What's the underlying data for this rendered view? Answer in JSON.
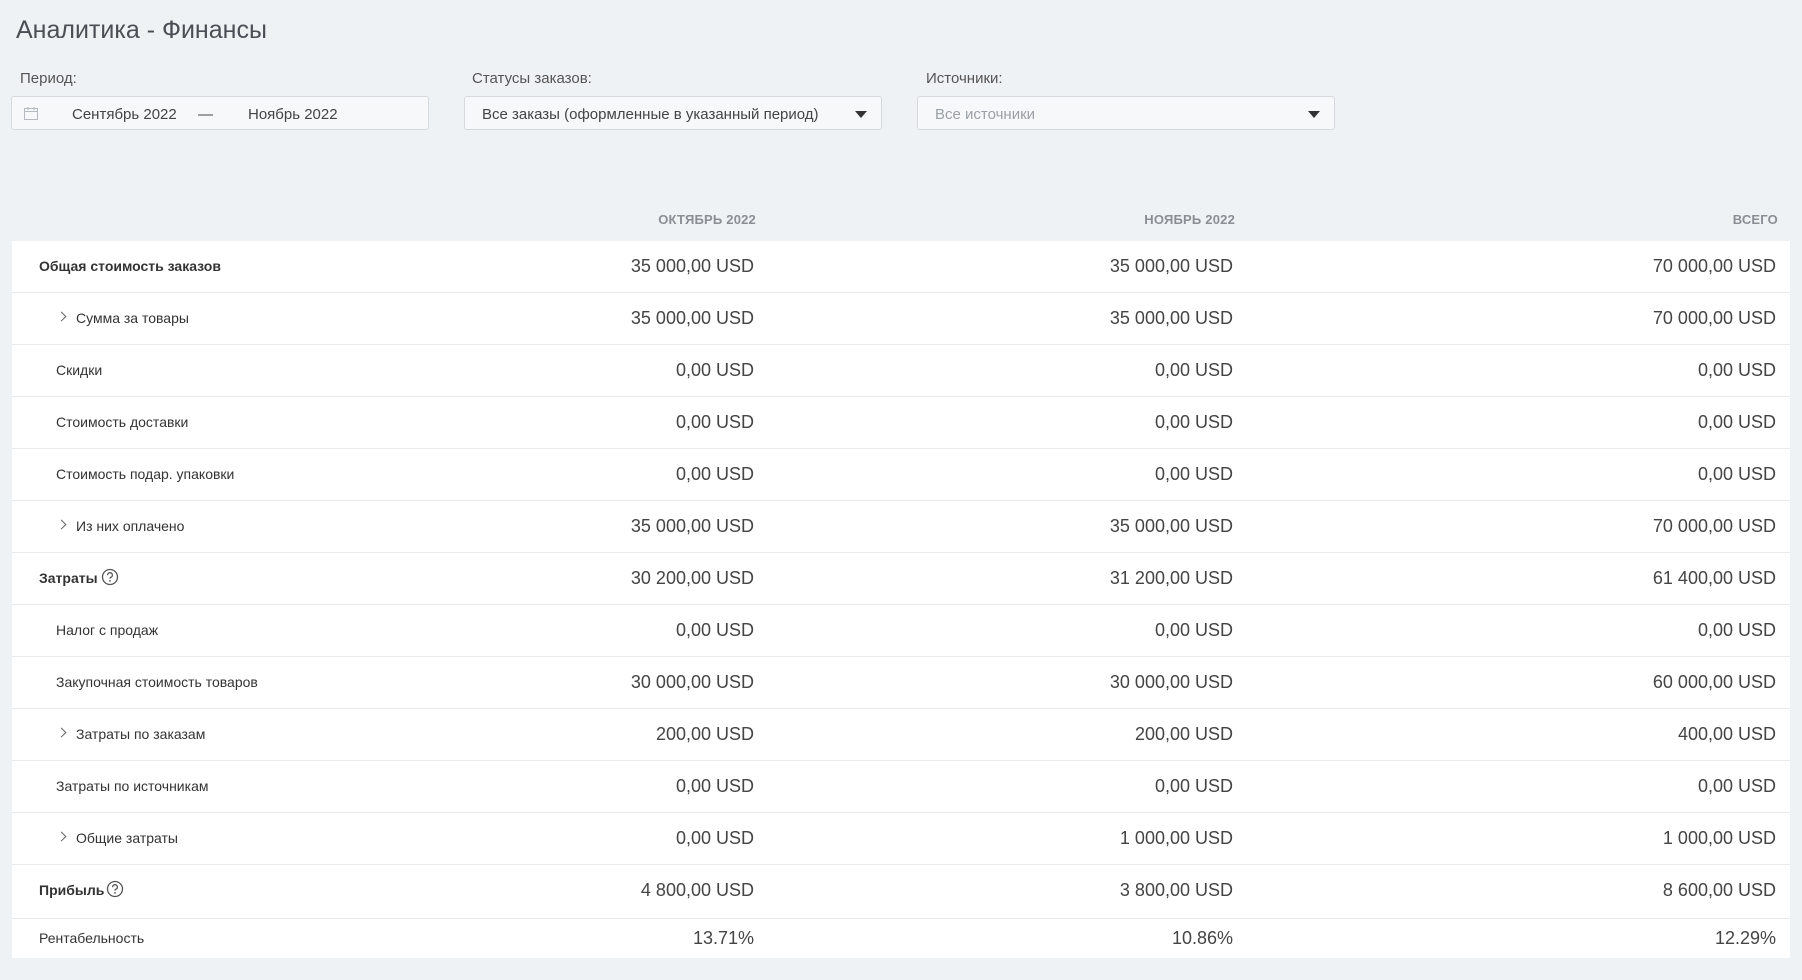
{
  "page_title": "Аналитика - Финансы",
  "filters": {
    "period": {
      "label": "Период:",
      "from": "Сентябрь 2022",
      "separator": "—",
      "to": "Ноябрь 2022"
    },
    "statuses": {
      "label": "Статусы заказов:",
      "value": "Все заказы (оформленные в указанный период)"
    },
    "sources": {
      "label": "Источники:",
      "placeholder": "Все источники"
    }
  },
  "columns": [
    "ОКТЯБРЬ 2022",
    "НОЯБРЬ 2022",
    "ВСЕГО"
  ],
  "rows": [
    {
      "label": "Общая стоимость заказов",
      "values": [
        "35 000,00 USD",
        "35 000,00 USD",
        "70 000,00 USD"
      ]
    },
    {
      "label": "Сумма за товары",
      "values": [
        "35 000,00 USD",
        "35 000,00 USD",
        "70 000,00 USD"
      ]
    },
    {
      "label": "Скидки",
      "values": [
        "0,00 USD",
        "0,00 USD",
        "0,00 USD"
      ]
    },
    {
      "label": "Стоимость доставки",
      "values": [
        "0,00 USD",
        "0,00 USD",
        "0,00 USD"
      ]
    },
    {
      "label": "Стоимость подар. упаковки",
      "values": [
        "0,00 USD",
        "0,00 USD",
        "0,00 USD"
      ]
    },
    {
      "label": "Из них оплачено",
      "values": [
        "35 000,00 USD",
        "35 000,00 USD",
        "70 000,00 USD"
      ]
    },
    {
      "label": "Затраты",
      "values": [
        "30 200,00 USD",
        "31 200,00 USD",
        "61 400,00 USD"
      ]
    },
    {
      "label": "Налог с продаж",
      "values": [
        "0,00 USD",
        "0,00 USD",
        "0,00 USD"
      ]
    },
    {
      "label": "Закупочная стоимость товаров",
      "values": [
        "30 000,00 USD",
        "30 000,00 USD",
        "60 000,00 USD"
      ]
    },
    {
      "label": "Затраты по заказам",
      "values": [
        "200,00 USD",
        "200,00 USD",
        "400,00 USD"
      ]
    },
    {
      "label": "Затраты по источникам",
      "values": [
        "0,00 USD",
        "0,00 USD",
        "0,00 USD"
      ]
    },
    {
      "label": "Общие затраты",
      "values": [
        "0,00 USD",
        "1 000,00 USD",
        "1 000,00 USD"
      ]
    },
    {
      "label": "Прибыль",
      "values": [
        "4 800,00 USD",
        "3 800,00 USD",
        "8 600,00 USD"
      ]
    },
    {
      "label": "Рентабельность",
      "values": [
        "13.71%",
        "10.86%",
        "12.29%"
      ]
    }
  ]
}
